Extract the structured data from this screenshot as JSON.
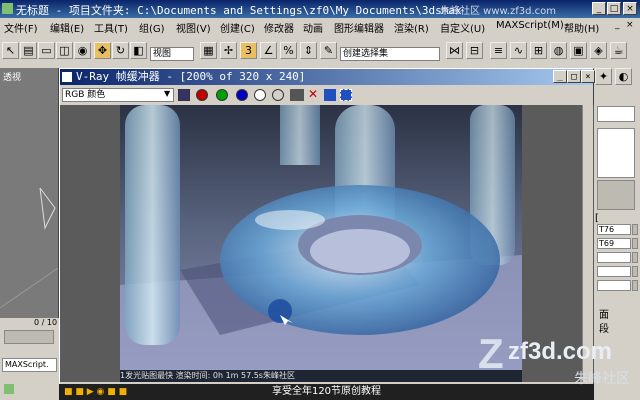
{
  "window": {
    "title": "无标题  - 项目文件夹: C:\\Documents and Settings\\zf0\\My Documents\\3dsmax",
    "watermark_site": "朱峰社区  www.zf3d.com",
    "min_label": "_",
    "max_label": "□",
    "close_label": "×"
  },
  "menu": [
    "文件(F)",
    "编辑(E)",
    "工具(T)",
    "组(G)",
    "视图(V)",
    "创建(C)",
    "修改器",
    "动画",
    "图形编辑器",
    "渲染(R)",
    "自定义(U)",
    "MAXScript(M)",
    "帮助(H)"
  ],
  "toolbar": {
    "view_select": "视图",
    "named_selection": "创建选择集"
  },
  "viewport": {
    "label": "透视",
    "timeline": "0 / 10",
    "maxscript": "MAXScript."
  },
  "vray": {
    "title": "V-Ray 帧缓冲器 - [200% of 320 x 240]",
    "channel": "RGB 颜色",
    "status": "1发光贴图最快 渲染时间: 0h 1m 57.5s朱峰社区",
    "min_label": "_",
    "max_label": "□",
    "close_label": "×"
  },
  "right_panel": {
    "fields": [
      "T76",
      "T69",
      "",
      "",
      ""
    ],
    "labels": [
      "[",
      "面",
      "段"
    ]
  },
  "caption": "享受全年120节原创教程",
  "watermark": {
    "logo": "zf3d.com",
    "sub": "朱峰社区"
  },
  "colors": {
    "title_bar": "#0a246a",
    "accent": "#3a6ea5",
    "render_bg": "#3a4458"
  }
}
